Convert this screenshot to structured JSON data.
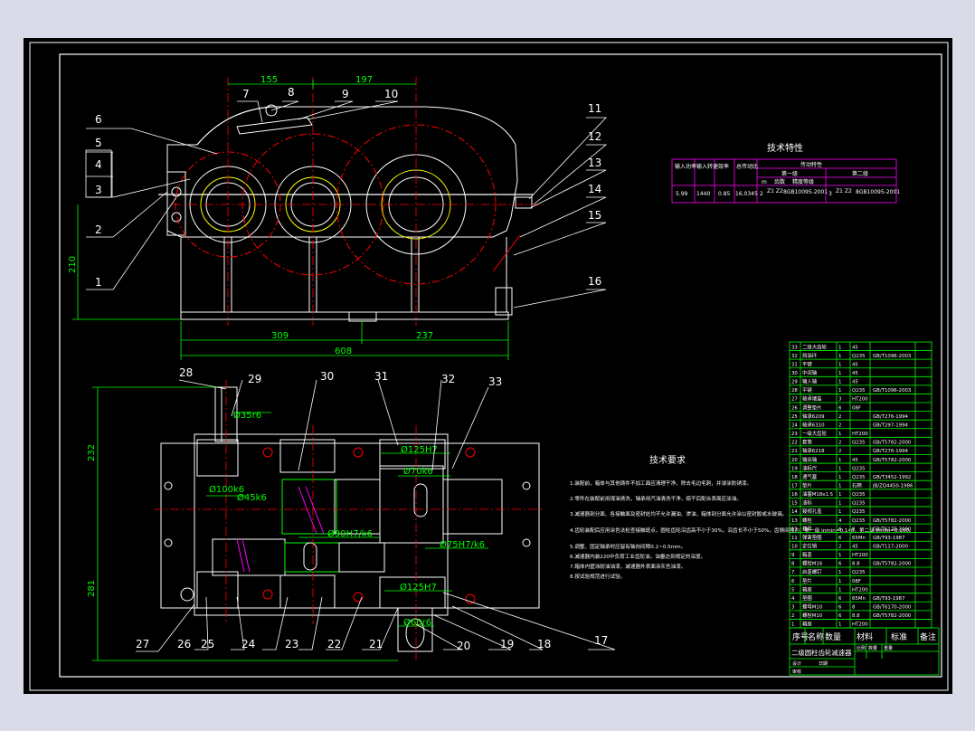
{
  "colors": {
    "viewport_bg": "#d9dbe8",
    "canvas_bg": "#000000",
    "line": "#ffffff",
    "green": "#00ff00",
    "red": "#ff0000",
    "magenta": "#ff00ff",
    "yellow": "#ffff00",
    "cyan": "#00ffff"
  },
  "dimensions": {
    "top_155": "155",
    "top_197": "197",
    "left_210": "210",
    "bottom_309": "309",
    "bottom_237": "237",
    "bottom_608": "608",
    "plan_232": "232",
    "plan_281": "281",
    "fit_35r6": "Ø35r6",
    "fit_100k6": "Ø100k6",
    "fit_45k6": "Ø45k6",
    "fit_125H7_top": "Ø125H7",
    "fit_70k6": "Ø70k6",
    "fit_90H7k6": "Ø90H7/k6",
    "fit_75H7k6": "Ø75H7/k6",
    "fit_125H7_bot": "Ø125H7",
    "fit_60r6": "Ø60r6"
  },
  "part_labels_front": [
    "1",
    "2",
    "3",
    "4",
    "5",
    "6",
    "7",
    "8",
    "9",
    "10",
    "11",
    "12",
    "13",
    "14",
    "15",
    "16"
  ],
  "part_labels_plan": [
    "17",
    "18",
    "19",
    "20",
    "21",
    "22",
    "23",
    "24",
    "25",
    "26",
    "27",
    "28",
    "29",
    "30",
    "31",
    "32",
    "33"
  ],
  "tech_spec": {
    "title": "技术特性",
    "headers": [
      "输入功率",
      "输入转速",
      "效率",
      "总传动比",
      "传动特性"
    ],
    "sub_headers": [
      "第一级",
      "第二级"
    ],
    "cols": [
      "m",
      "齿数",
      "精度等级"
    ],
    "row": [
      "5.99",
      "1440",
      "0.85",
      "16.0345",
      "2",
      "Z1 Z2",
      "8GB10095-2001",
      "3",
      "Z1 Z2",
      "8GB10095-2001"
    ]
  },
  "tech_req": {
    "title": "技术要求",
    "items": [
      "1.装配前，箱体与其他铸件不加工面应清理干净，除去毛边毛刺，并浸涂防锈漆。",
      "2.零件在装配前用煤油清洗，轴承用汽油清洗干净，晾干后配合表面应涂油。",
      "3.减速器剖分面、各接触面及密封处均不允许漏油、渗油，箱体剖分面允许涂以密封胶或水玻璃。",
      "4.齿轮装配后应用涂色法检查接触斑点，圆柱齿轮沿齿高不小于30%，沿齿长不小于50%，齿侧间隙为：第一级 jnmin=0.140，第二级 jnmin=0.160。",
      "5.调整、固定轴承时应留有轴向间隙0.2~0.5mm。",
      "6.减速器内装220中负荷工业齿轮油，油量达到规定的深度。",
      "7.箱体内壁涂耐油油漆，减速器外表面涂灰色油漆。",
      "8.按试验规范进行试验。"
    ]
  },
  "bom": {
    "rows": [
      [
        "33",
        "二级大齿轮",
        "1",
        "45",
        ""
      ],
      [
        "32",
        "挡油环",
        "1",
        "Q235",
        "GB/T1096-2003"
      ],
      [
        "31",
        "平键",
        "1",
        "45",
        ""
      ],
      [
        "30",
        "中间轴",
        "1",
        "45",
        ""
      ],
      [
        "29",
        "输入轴",
        "1",
        "45",
        ""
      ],
      [
        "28",
        "平键",
        "1",
        "Q235",
        "GB/T1096-2003"
      ],
      [
        "27",
        "轴承端盖",
        "3",
        "HT200",
        ""
      ],
      [
        "26",
        "调整垫片",
        "6",
        "08F",
        ""
      ],
      [
        "25",
        "轴承6209",
        "2",
        "",
        "GB/T276-1994"
      ],
      [
        "24",
        "轴承6310",
        "2",
        "",
        "GB/T297-1994"
      ],
      [
        "23",
        "一级大齿轮",
        "1",
        "HT200",
        ""
      ],
      [
        "22",
        "套筒",
        "2",
        "Q235",
        "GB/T5782-2000"
      ],
      [
        "21",
        "轴承6218",
        "2",
        "",
        "GB/T276-1994"
      ],
      [
        "20",
        "输出轴",
        "1",
        "45",
        "GB/T5782-2000"
      ],
      [
        "19",
        "油标尺",
        "1",
        "Q235",
        ""
      ],
      [
        "18",
        "通气塞",
        "1",
        "Q235",
        "GB/T3452-1992"
      ],
      [
        "17",
        "垫片",
        "1",
        "石棉",
        "JB/ZQ4450-1986"
      ],
      [
        "16",
        "油塞M18x1.5",
        "1",
        "Q235",
        ""
      ],
      [
        "15",
        "油标",
        "1",
        "Q235",
        ""
      ],
      [
        "14",
        "窥视孔盖",
        "1",
        "Q235",
        ""
      ],
      [
        "13",
        "螺栓",
        "4",
        "Q235",
        "GB/T5782-2000"
      ],
      [
        "12",
        "螺母",
        "6",
        "8",
        "GB/T6170-2000"
      ],
      [
        "11",
        "弹簧垫圈",
        "6",
        "65Mn",
        "GB/T93-1987"
      ],
      [
        "10",
        "定位销",
        "2",
        "45",
        "GB/T117-2000"
      ],
      [
        "9",
        "箱盖",
        "1",
        "HT200",
        ""
      ],
      [
        "8",
        "螺栓M16",
        "6",
        "8.8",
        "GB/T5782-2000"
      ],
      [
        "7",
        "启盖螺钉",
        "1",
        "Q235",
        ""
      ],
      [
        "6",
        "垫片",
        "1",
        "08F",
        ""
      ],
      [
        "5",
        "箱座",
        "1",
        "HT200",
        ""
      ],
      [
        "4",
        "垫圈",
        "6",
        "65Mn",
        "GB/T93-1987"
      ],
      [
        "3",
        "螺母M10",
        "6",
        "8",
        "GB/T6170-2000"
      ],
      [
        "2",
        "螺栓M10",
        "6",
        "8.8",
        "GB/T5782-2000"
      ],
      [
        "1",
        "箱座",
        "1",
        "HT200",
        ""
      ]
    ],
    "header": [
      "序号",
      "名称",
      "数量",
      "材料",
      "标准",
      "备注"
    ],
    "title": "二级圆柱齿轮减速器",
    "title_cols": [
      "比例",
      "数量",
      "重量"
    ],
    "sign_rows": [
      "设计",
      "审核",
      "日期"
    ]
  }
}
